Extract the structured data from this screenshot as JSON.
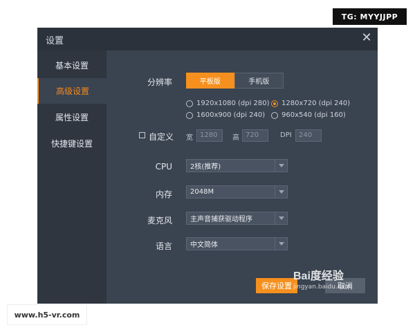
{
  "watermarks": {
    "top": "TG: MYYJJPP",
    "bottom": "www.h5-vr.com",
    "baidu_brand": "Bai度经验",
    "baidu_url": "jingyan.baidu.com"
  },
  "dialog": {
    "title": "设置",
    "close_glyph": "✕"
  },
  "sidebar": {
    "items": [
      {
        "label": "基本设置",
        "active": false
      },
      {
        "label": "高级设置",
        "active": true
      },
      {
        "label": "属性设置",
        "active": false
      },
      {
        "label": "快捷键设置",
        "active": false
      }
    ]
  },
  "resolution": {
    "label": "分辨率",
    "modes": [
      {
        "label": "平板版",
        "selected": true
      },
      {
        "label": "手机版",
        "selected": false
      }
    ],
    "options": [
      {
        "label": "1920x1080 (dpi 280)",
        "checked": false
      },
      {
        "label": "1280x720 (dpi 240)",
        "checked": true
      },
      {
        "label": "1600x900 (dpi 240)",
        "checked": false
      },
      {
        "label": "960x540 (dpi 160)",
        "checked": false
      }
    ]
  },
  "custom": {
    "label": "自定义",
    "width_label": "宽",
    "width_value": "1280",
    "height_label": "高",
    "height_value": "720",
    "dpi_label": "DPI",
    "dpi_value": "240"
  },
  "cpu": {
    "label": "CPU",
    "value": "2核(推荐)"
  },
  "memory": {
    "label": "内存",
    "value": "2048M"
  },
  "mic": {
    "label": "麦克风",
    "value": "主声音捕获驱动程序"
  },
  "language": {
    "label": "语言",
    "value": "中文简体"
  },
  "buttons": {
    "save": "保存设置",
    "cancel": "取消"
  },
  "colors": {
    "accent": "#f5901e",
    "panel": "#3a4350",
    "sidebar": "#2f3640",
    "titlebar": "#2b323c"
  }
}
